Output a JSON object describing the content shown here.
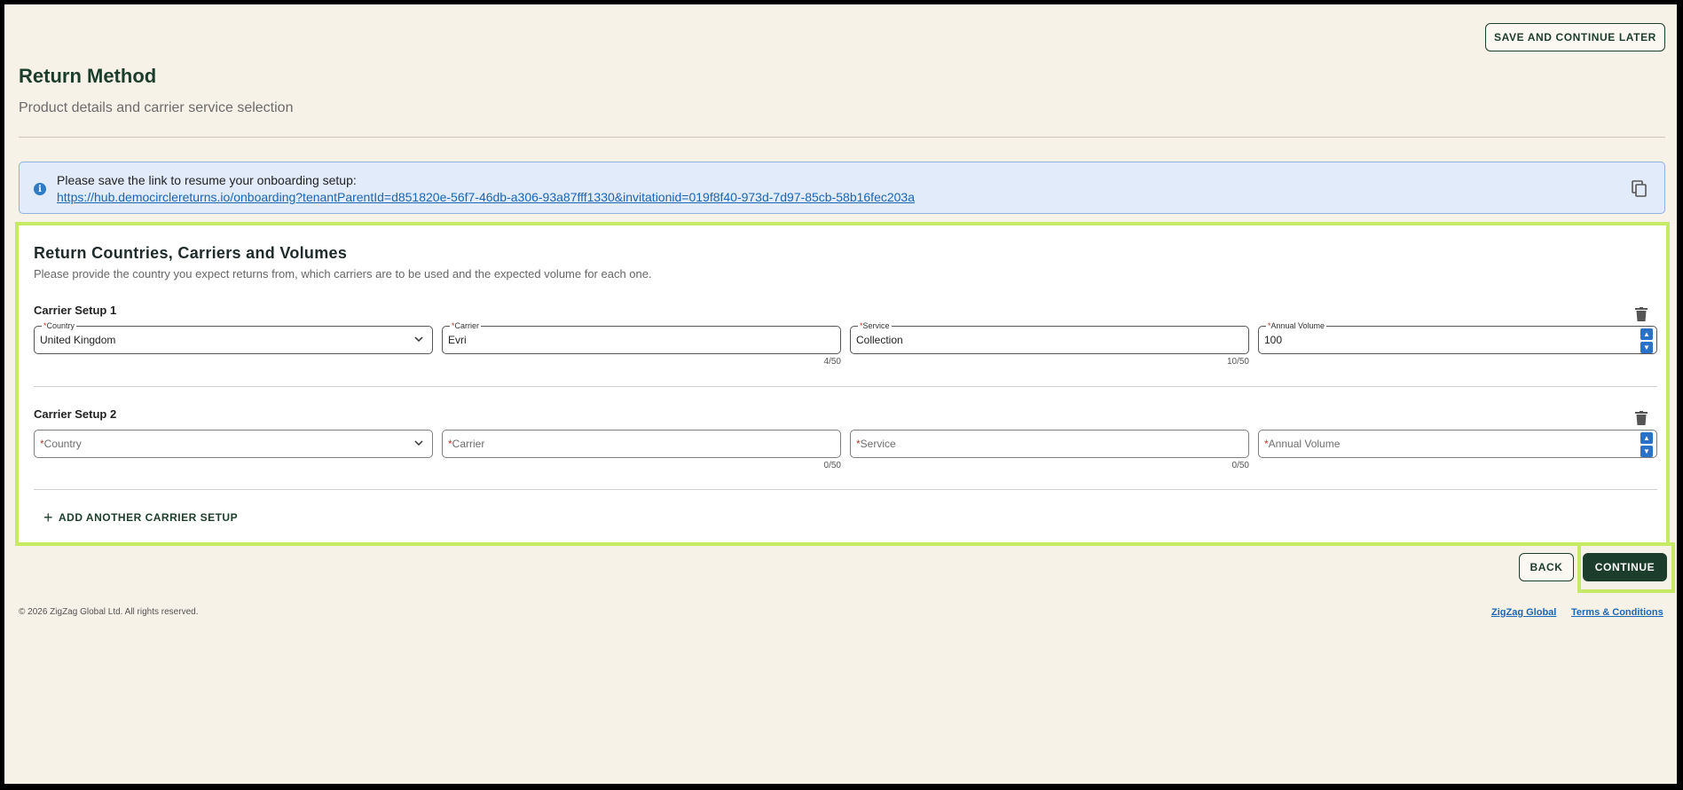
{
  "header": {
    "save_later_label": "SAVE AND CONTINUE LATER",
    "title": "Return Method",
    "subtitle": "Product details and carrier service selection"
  },
  "banner": {
    "message": "Please save the link to resume your onboarding setup:",
    "link": "https://hub.democirclereturns.io/onboarding?tenantParentId=d851820e-56f7-46db-a306-93a87fff1330&invitationid=019f8f40-973d-7d97-85cb-58b16fec203a"
  },
  "section": {
    "title": "Return Countries, Carriers and Volumes",
    "description": "Please provide the country you expect returns from, which carriers are to be used and the expected volume for each one."
  },
  "labels": {
    "required_mark": "*",
    "country": "Country",
    "carrier": "Carrier",
    "service": "Service",
    "annual_volume": "Annual Volume"
  },
  "setups": [
    {
      "title": "Carrier Setup 1",
      "country": "United Kingdom",
      "carrier": "Evri",
      "carrier_count": "4/50",
      "service": "Collection",
      "service_count": "10/50",
      "annual_volume": "100"
    },
    {
      "title": "Carrier Setup 2",
      "country": "",
      "carrier": "",
      "carrier_count": "0/50",
      "service": "",
      "service_count": "0/50",
      "annual_volume": ""
    }
  ],
  "actions": {
    "add_setup_label": "ADD ANOTHER CARRIER SETUP",
    "back_label": "BACK",
    "continue_label": "CONTINUE"
  },
  "footer": {
    "copyright": "© 2026 ZigZag Global Ltd. All rights reserved.",
    "link_company": "ZigZag Global",
    "link_terms": "Terms & Conditions"
  },
  "colors": {
    "page_bg": "#f7f2e7",
    "brand_dark_green": "#1c3d2b",
    "highlight_lime": "#c6ea63",
    "info_bg": "#e1ebfa",
    "link_blue": "#1a66b5"
  },
  "icons": [
    "info-icon",
    "copy-icon",
    "trash-icon",
    "chevron-down-icon",
    "stepper-up-icon",
    "stepper-down-icon",
    "plus-icon"
  ]
}
